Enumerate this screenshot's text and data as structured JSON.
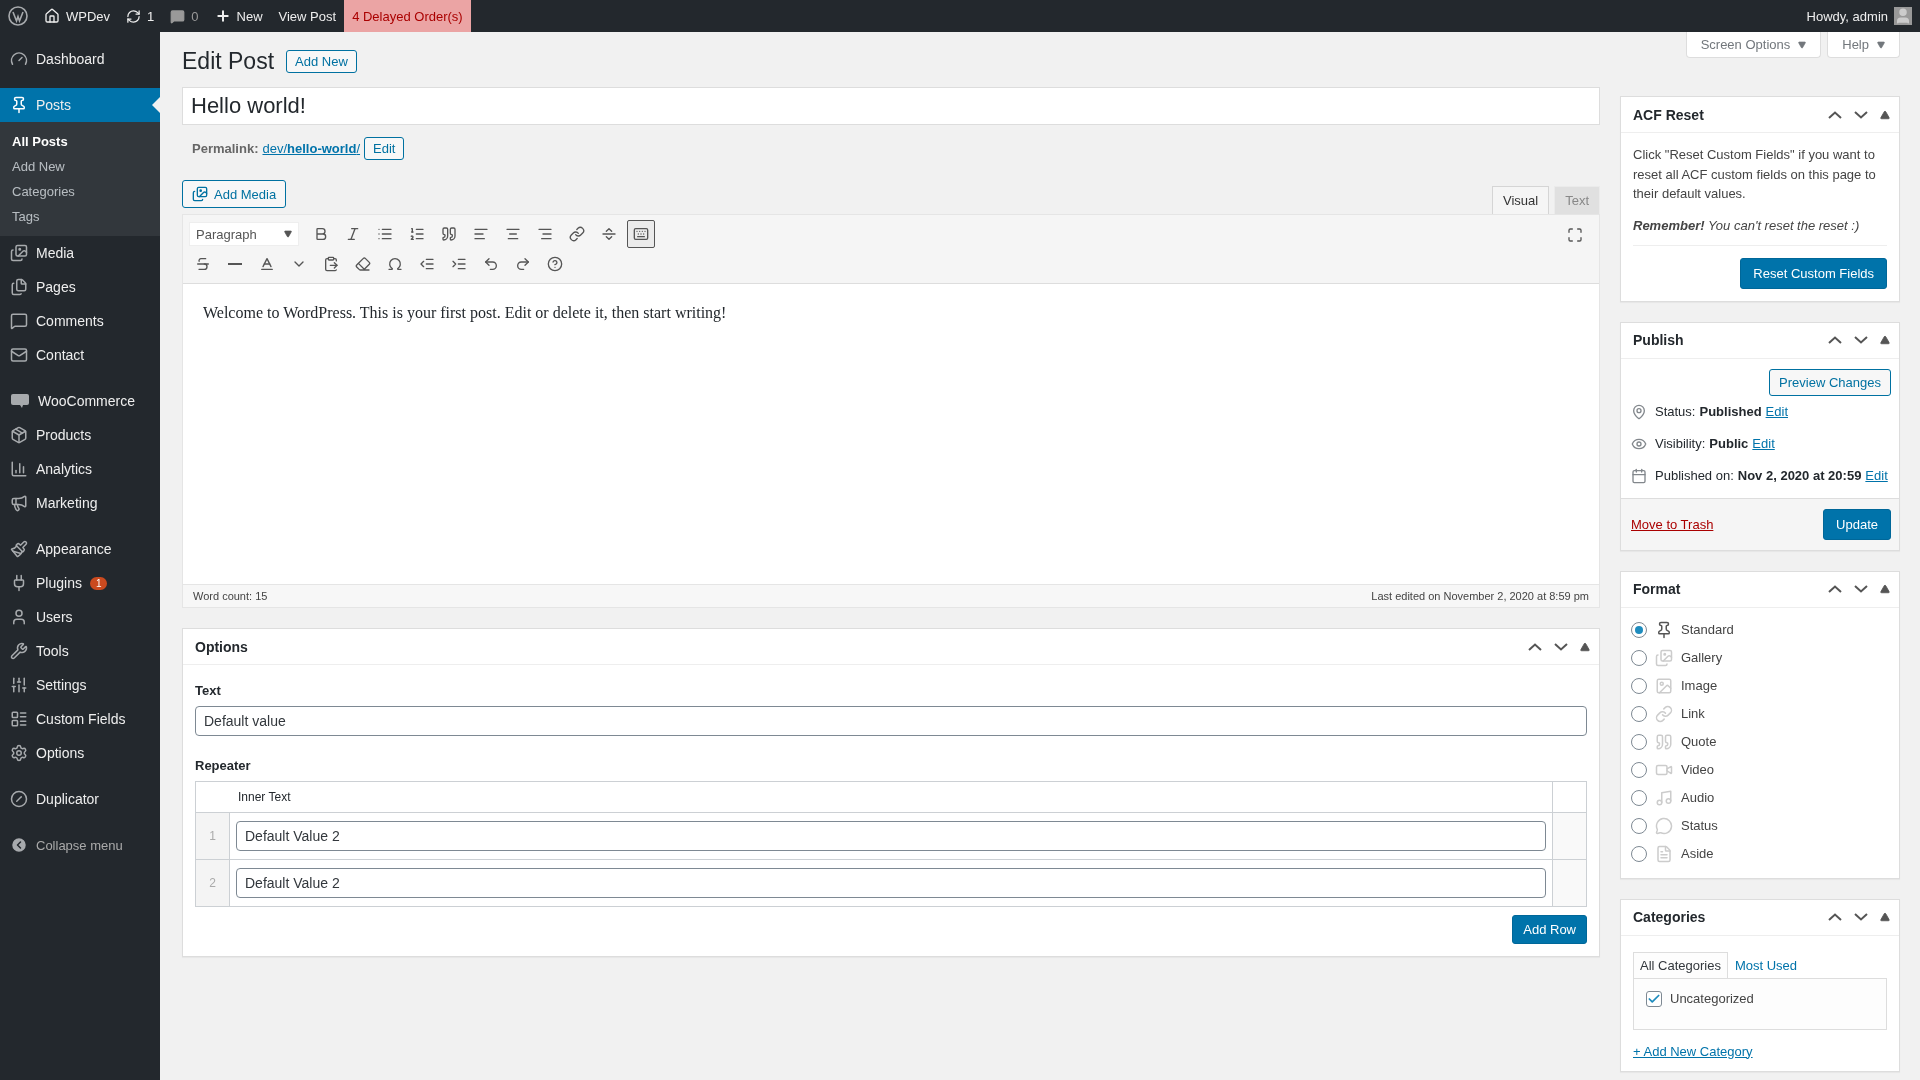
{
  "admin_bar": {
    "items": [
      {
        "kind": "logo"
      },
      {
        "kind": "site",
        "label": "WPDev"
      },
      {
        "kind": "updates",
        "label": "1"
      },
      {
        "kind": "comments",
        "label": "0"
      },
      {
        "kind": "new",
        "label": "New"
      },
      {
        "kind": "link",
        "label": "View Post"
      },
      {
        "kind": "alert",
        "label": "4 Delayed Order(s)"
      }
    ],
    "account": "Howdy, admin"
  },
  "sidebar": {
    "groups": [
      [
        {
          "label": "Dashboard",
          "selected": false
        }
      ],
      [
        {
          "label": "Posts",
          "selected": true,
          "submenu": [
            {
              "label": "All Posts",
              "selected": true
            },
            {
              "label": "Add New",
              "selected": false
            },
            {
              "label": "Categories",
              "selected": false
            },
            {
              "label": "Tags",
              "selected": false
            }
          ]
        },
        {
          "label": "Media",
          "selected": false
        },
        {
          "label": "Pages",
          "selected": false
        },
        {
          "label": "Comments",
          "selected": false
        },
        {
          "label": "Contact",
          "selected": false
        }
      ],
      [
        {
          "label": "WooCommerce",
          "selected": false
        },
        {
          "label": "Products",
          "selected": false
        },
        {
          "label": "Analytics",
          "selected": false
        },
        {
          "label": "Marketing",
          "selected": false
        }
      ],
      [
        {
          "label": "Appearance",
          "selected": false
        },
        {
          "label": "Plugins",
          "selected": false,
          "badge": "1"
        },
        {
          "label": "Users",
          "selected": false
        },
        {
          "label": "Tools",
          "selected": false
        },
        {
          "label": "Settings",
          "selected": false
        },
        {
          "label": "Custom Fields",
          "selected": false
        },
        {
          "label": "Options",
          "selected": false
        }
      ],
      [
        {
          "label": "Duplicator",
          "selected": false
        }
      ]
    ],
    "collapse": "Collapse menu"
  },
  "screen_meta": [
    "Screen Options",
    "Help"
  ],
  "header": {
    "title": "Edit Post",
    "add_new": "Add New"
  },
  "post_title": "Hello world!",
  "permalink": {
    "label": "Permalink:",
    "url": "dev/**hello-world**/",
    "edit": "Edit"
  },
  "editor": {
    "add_media": "Add Media",
    "tabs": [
      {
        "label": "Visual",
        "selected": true
      },
      {
        "label": "Text",
        "selected": false
      }
    ],
    "format": "Paragraph",
    "toolbar_rows": [
      [
        {
          "pressed": false
        },
        {
          "pressed": false
        },
        {
          "pressed": false
        },
        {
          "pressed": false
        },
        {
          "pressed": false
        },
        {
          "pressed": false
        },
        {
          "pressed": false
        },
        {
          "pressed": false
        },
        {
          "pressed": false
        },
        {
          "pressed": false
        },
        {
          "pressed": true
        }
      ],
      [
        {
          "pressed": false
        },
        {
          "pressed": false
        },
        {
          "pressed": false
        },
        {
          "pressed": false
        },
        {
          "pressed": false
        },
        {
          "pressed": false
        },
        {
          "pressed": false
        },
        {
          "pressed": false
        },
        {
          "pressed": false
        },
        {
          "pressed": false
        },
        {
          "pressed": false
        },
        {
          "pressed": false
        }
      ]
    ],
    "content": "Welcome to WordPress. This is your first post. Edit or delete it, then start writing!",
    "word_count": "Word count: 15",
    "last_edited": "Last edited on November 2, 2020 at 8:59 pm"
  },
  "options_box": {
    "title": "Options",
    "text_label": "Text",
    "text_value": "Default value",
    "repeater_label": "Repeater",
    "column": "Inner Text",
    "rows": [
      {
        "index": "1",
        "value": "Default Value 2"
      },
      {
        "index": "2",
        "value": "Default Value 2"
      }
    ],
    "add_row": "Add Row"
  },
  "acf_reset": {
    "title": "ACF Reset",
    "description": "Click \"Reset Custom Fields\" if you want to reset all ACF custom fields on this page to their default values.",
    "note": "**Remember!** You can't reset the reset :)",
    "button": "Reset Custom Fields"
  },
  "publish": {
    "title": "Publish",
    "preview": "Preview Changes",
    "rows": [
      {
        "label": "Status:",
        "value": "Published",
        "link": "Edit"
      },
      {
        "label": "Visibility:",
        "value": "Public",
        "link": "Edit"
      },
      {
        "label": "Published on:",
        "value": "Nov 2, 2020 at 20:59",
        "link": "Edit"
      }
    ],
    "trash": "Move to Trash",
    "update": "Update"
  },
  "format": {
    "title": "Format",
    "options": [
      {
        "label": "Standard",
        "selected": true
      },
      {
        "label": "Gallery",
        "selected": false
      },
      {
        "label": "Image",
        "selected": false
      },
      {
        "label": "Link",
        "selected": false
      },
      {
        "label": "Quote",
        "selected": false
      },
      {
        "label": "Video",
        "selected": false
      },
      {
        "label": "Audio",
        "selected": false
      },
      {
        "label": "Status",
        "selected": false
      },
      {
        "label": "Aside",
        "selected": false
      }
    ]
  },
  "categories": {
    "title": "Categories",
    "tabs": [
      {
        "label": "All Categories",
        "selected": true
      },
      {
        "label": "Most Used",
        "selected": false
      }
    ],
    "items": [
      {
        "label": "Uncategorized",
        "checked": true
      }
    ],
    "add_link": "+ Add New Category"
  }
}
